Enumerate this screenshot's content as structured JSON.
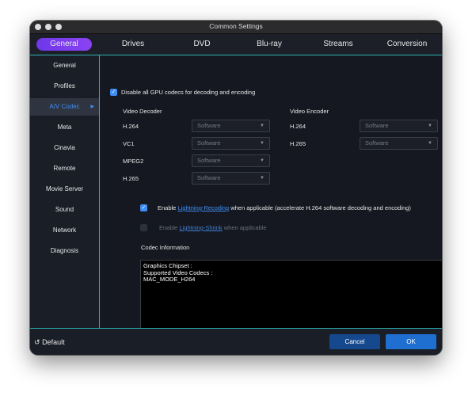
{
  "window": {
    "title": "Common Settings"
  },
  "tabs": [
    {
      "label": "General"
    },
    {
      "label": "Drives"
    },
    {
      "label": "DVD"
    },
    {
      "label": "Blu-ray"
    },
    {
      "label": "Streams"
    },
    {
      "label": "Conversion"
    }
  ],
  "sidebar": {
    "items": [
      {
        "label": "General"
      },
      {
        "label": "Profiles"
      },
      {
        "label": "A/V Codec"
      },
      {
        "label": "Meta"
      },
      {
        "label": "Cinavia"
      },
      {
        "label": "Remote"
      },
      {
        "label": "Movie Server"
      },
      {
        "label": "Sound"
      },
      {
        "label": "Network"
      },
      {
        "label": "Diagnosis"
      }
    ],
    "active_caret": "▶"
  },
  "av_codec": {
    "disable_gpu": {
      "label": "Disable all GPU codecs for decoding and encoding",
      "checked": true
    },
    "video_decoder": {
      "heading": "Video Decoder",
      "rows": [
        {
          "codec": "H.264",
          "value": "Software"
        },
        {
          "codec": "VC1",
          "value": "Software"
        },
        {
          "codec": "MPEG2",
          "value": "Software"
        },
        {
          "codec": "H.265",
          "value": "Software"
        }
      ]
    },
    "video_encoder": {
      "heading": "Video Encoder",
      "rows": [
        {
          "codec": "H.264",
          "value": "Software"
        },
        {
          "codec": "H.265",
          "value": "Software"
        }
      ]
    },
    "lightning_recoding": {
      "prefix": "Enable",
      "link": "Lightning-Recoding",
      "suffix": "when applicable (accelerate H.264 software decoding and encoding)",
      "checked": true
    },
    "lightning_shrink": {
      "prefix": "Enable",
      "link": "Lightning-Shrink",
      "suffix": "when applicable",
      "checked": false,
      "enabled": false
    },
    "codec_info": {
      "heading": "Codec Information",
      "lines": [
        "Graphics Chipset :",
        "Supported Video Codecs :",
        "MAC_MODE_H264"
      ]
    }
  },
  "footer": {
    "default_label": "Default",
    "cancel_label": "Cancel",
    "ok_label": "OK"
  },
  "colors": {
    "accent": "#3f8ef5",
    "tab_active": "#7a3bf0",
    "separator": "#2bb3b3",
    "background": "#151820"
  }
}
